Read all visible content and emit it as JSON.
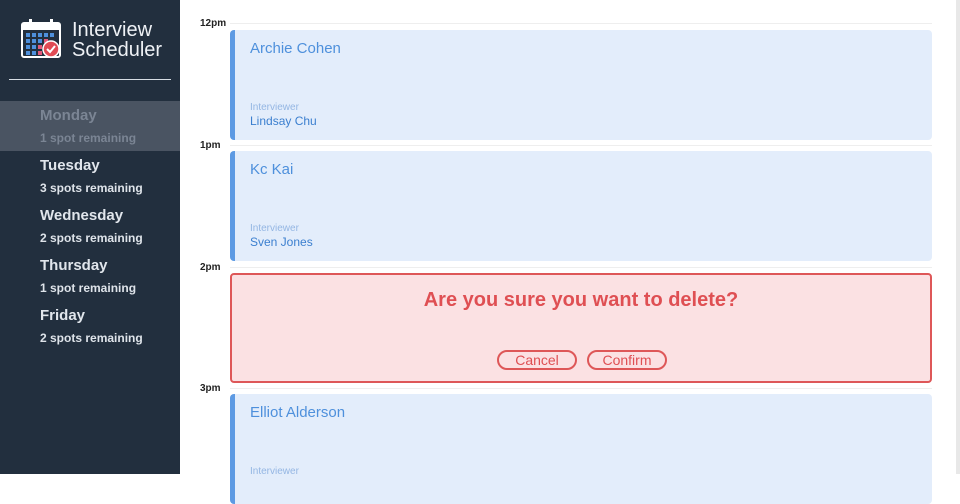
{
  "app": {
    "title_line1": "Interview",
    "title_line2": "Scheduler",
    "logo_icon": "calendar-check-icon"
  },
  "days": [
    {
      "name": "Monday",
      "spots": "1 spot remaining",
      "selected": true
    },
    {
      "name": "Tuesday",
      "spots": "3 spots remaining",
      "selected": false
    },
    {
      "name": "Wednesday",
      "spots": "2 spots remaining",
      "selected": false
    },
    {
      "name": "Thursday",
      "spots": "1 spot remaining",
      "selected": false
    },
    {
      "name": "Friday",
      "spots": "2 spots remaining",
      "selected": false
    }
  ],
  "schedule": {
    "times": [
      "12pm",
      "1pm",
      "2pm",
      "3pm"
    ],
    "appointments": [
      {
        "student": "Archie Cohen",
        "interviewer_label": "Interviewer",
        "interviewer": "Lindsay Chu"
      },
      {
        "student": "Kc Kai",
        "interviewer_label": "Interviewer",
        "interviewer": "Sven Jones"
      },
      {
        "student": "Elliot Alderson",
        "interviewer_label": "Interviewer"
      }
    ],
    "confirm": {
      "message": "Are you sure you want to delete?",
      "cancel_label": "Cancel",
      "confirm_label": "Confirm"
    }
  },
  "colors": {
    "sidebar_bg": "#222f3e",
    "card_bg": "#e3edfb",
    "accent_blue": "#5d9ae3",
    "danger": "#de5758"
  }
}
